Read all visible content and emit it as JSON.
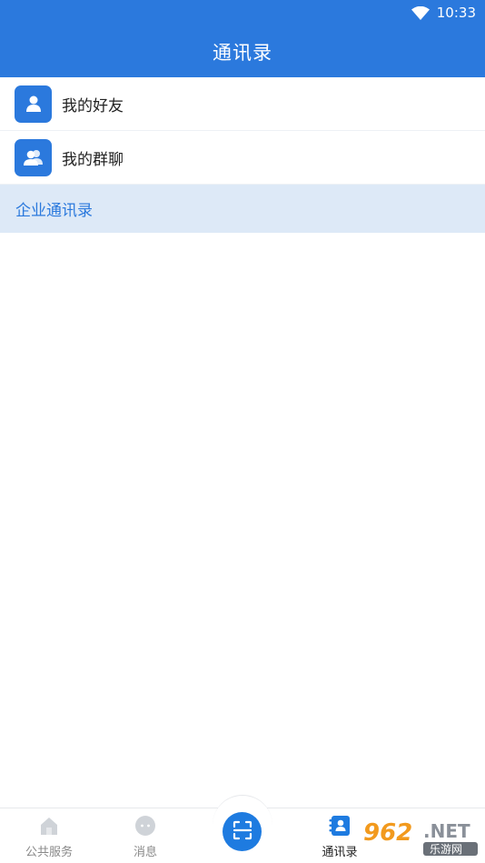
{
  "status_bar": {
    "time": "10:33",
    "icon": "wifi-icon"
  },
  "header": {
    "title": "通讯录"
  },
  "contacts": {
    "items": [
      {
        "label": "我的好友",
        "icon": "person-icon"
      },
      {
        "label": "我的群聊",
        "icon": "group-icon"
      }
    ]
  },
  "section": {
    "label": "企业通讯录"
  },
  "tabbar": {
    "tabs": [
      {
        "label": "公共服务",
        "icon": "home-icon",
        "active": false
      },
      {
        "label": "消息",
        "icon": "chat-icon",
        "active": false
      },
      {
        "label": "",
        "icon": "scan-icon",
        "active": false
      },
      {
        "label": "通讯录",
        "icon": "contacts-icon",
        "active": true
      }
    ]
  },
  "watermark": {
    "text": "962.NET",
    "subtext": "乐游网"
  },
  "colors": {
    "primary": "#2b79dd",
    "section_bg": "#dde9f7",
    "inactive": "#888888"
  }
}
